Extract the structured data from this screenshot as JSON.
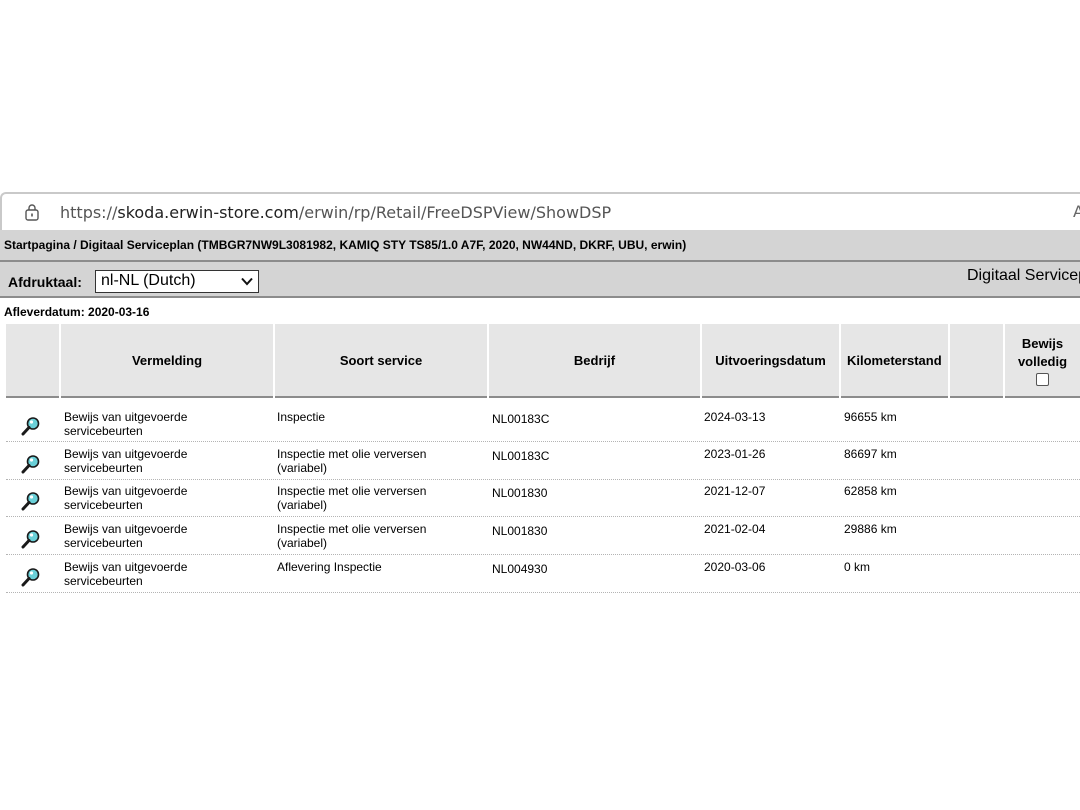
{
  "browser": {
    "url_scheme": "https://",
    "url_host": "skoda.erwin-store.com",
    "url_path": "/erwin/rp/Retail/FreeDSPView/ShowDSP",
    "overflow_glyph": "A"
  },
  "breadcrumb": "Startpagina / Digitaal Serviceplan (TMBGR7NW9L3081982, KAMIQ STY TS85/1.0 A7F, 2020, NW44ND, DKRF, UBU, erwin)",
  "language": {
    "label": "Afdruktaal:",
    "selected": "nl-NL (Dutch)"
  },
  "doc_title": "Digitaal Servicep",
  "delivery_date": "Afleverdatum: 2020-03-16",
  "table": {
    "headers": {
      "vermelding": "Vermelding",
      "soort": "Soort service",
      "bedrijf": "Bedrijf",
      "datum": "Uitvoeringsdatum",
      "km": "Kilometerstand",
      "bewijs_line1": "Bewijs",
      "bewijs_line2": "volledig"
    },
    "rows": [
      {
        "vermelding_1": "Bewijs van uitgevoerde",
        "vermelding_2": "servicebeurten",
        "soort_1": "Inspectie",
        "soort_2": "",
        "bedrijf": "NL00183C",
        "datum": "2024-03-13",
        "km": "96655 km"
      },
      {
        "vermelding_1": "Bewijs van uitgevoerde",
        "vermelding_2": "servicebeurten",
        "soort_1": "Inspectie met olie verversen",
        "soort_2": "(variabel)",
        "bedrijf": "NL00183C",
        "datum": "2023-01-26",
        "km": "86697 km"
      },
      {
        "vermelding_1": "Bewijs van uitgevoerde",
        "vermelding_2": "servicebeurten",
        "soort_1": "Inspectie met olie verversen",
        "soort_2": "(variabel)",
        "bedrijf": "NL001830",
        "datum": "2021-12-07",
        "km": "62858 km"
      },
      {
        "vermelding_1": "Bewijs van uitgevoerde",
        "vermelding_2": "servicebeurten",
        "soort_1": "Inspectie met olie verversen",
        "soort_2": "(variabel)",
        "bedrijf": "NL001830",
        "datum": "2021-02-04",
        "km": "29886 km"
      },
      {
        "vermelding_1": "Bewijs van uitgevoerde",
        "vermelding_2": "servicebeurten",
        "soort_1": "Aflevering Inspectie",
        "soort_2": "",
        "bedrijf": "NL004930",
        "datum": "2020-03-06",
        "km": "0 km"
      }
    ]
  },
  "icons": {
    "row_action": "magnifier-icon",
    "address_lock": "lock-icon",
    "select_arrow": "chevron-down-icon"
  },
  "colors": {
    "bar_gray": "#d4d4d4",
    "header_gray": "#e6e6e6",
    "magnifier_lens": "#6ad0d8"
  }
}
